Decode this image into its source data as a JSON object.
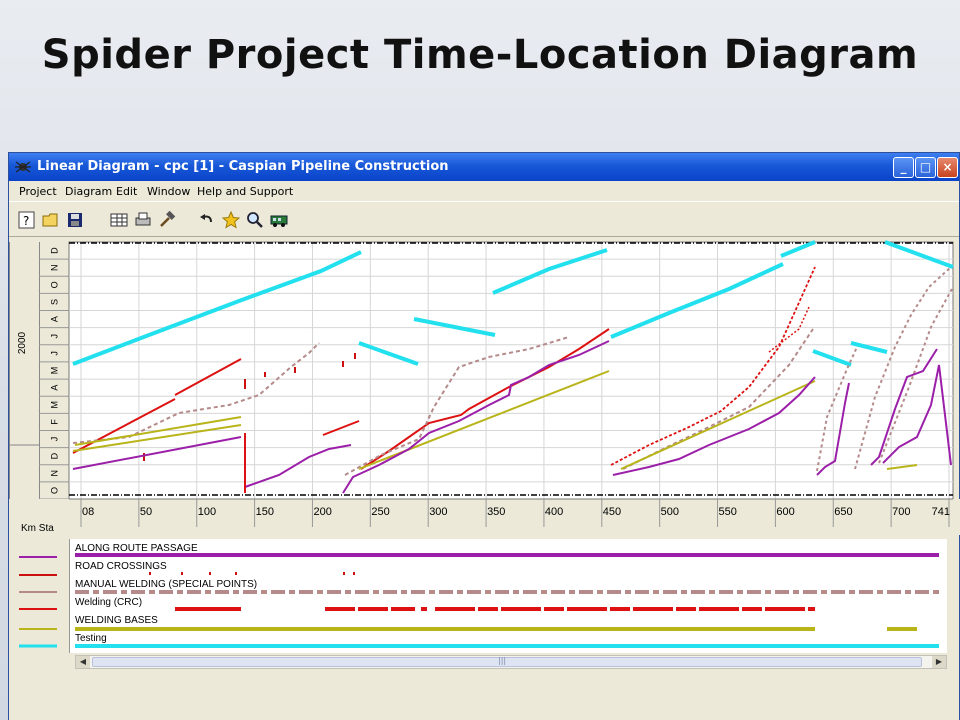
{
  "slide": {
    "title": "Spider Project Time-Location Diagram"
  },
  "window": {
    "title": "Linear Diagram - cpc [1] - Caspian Pipeline Construction",
    "controls": {
      "minimize": "_",
      "maximize": "□",
      "close": "×"
    }
  },
  "menu": [
    "Project",
    "Diagram",
    "Edit",
    "Window",
    "Help and Support"
  ],
  "toolbar_icons": [
    "help-icon",
    "open-folder-icon",
    "save-icon",
    "table-icon",
    "print-icon",
    "hammer-icon",
    "undo-icon",
    "star-icon",
    "zoom-icon",
    "bus-icon"
  ],
  "time_axis": {
    "year_label": "2000",
    "months": [
      "D",
      "N",
      "O",
      "S",
      "A",
      "J",
      "J",
      "M",
      "A",
      "M",
      "F",
      "J",
      "D",
      "N",
      "O"
    ]
  },
  "km_axis": {
    "label": "Km Sta",
    "ticks": [
      "08",
      "50",
      "100",
      "150",
      "200",
      "250",
      "300",
      "350",
      "400",
      "450",
      "500",
      "550",
      "600",
      "650",
      "700",
      "741"
    ]
  },
  "legend": [
    {
      "name": "ALONG ROUTE PASSAGE",
      "color": "#9b1fa8"
    },
    {
      "name": "ROAD CROSSINGS",
      "color": "#cc1010"
    },
    {
      "name": "MANUAL WELDING (SPECIAL POINTS)",
      "color": "#b48a8a"
    },
    {
      "name": "Welding (CRC)",
      "color": "#dd1111"
    },
    {
      "name": "WELDING BASES",
      "color": "#b8b41a"
    },
    {
      "name": "Testing",
      "color": "#22e0ee"
    }
  ],
  "scrollbar": {
    "left_arrow": "◀",
    "right_arrow": "▶",
    "grip": "|||"
  }
}
